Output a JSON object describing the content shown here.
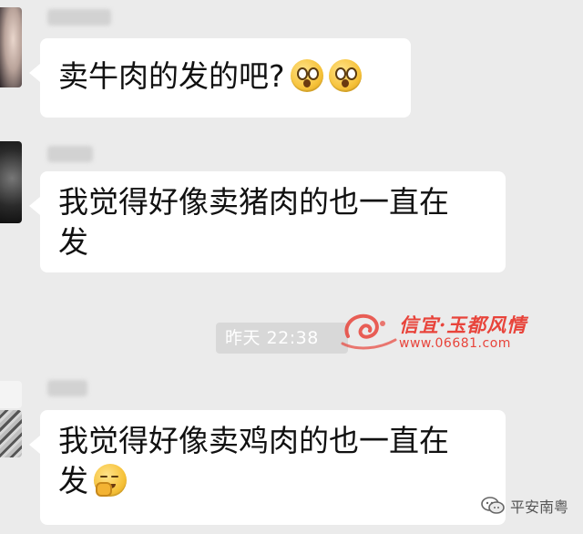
{
  "messages": [
    {
      "text": "卖牛肉的发的吧?",
      "emojis": [
        "astonished",
        "astonished"
      ]
    },
    {
      "line1": "我觉得好像卖猪肉的也一直在",
      "line2": "发"
    },
    {
      "line1": "我觉得好像卖鸡肉的也一直在",
      "line2": "发",
      "emoji": "shy"
    }
  ],
  "timestamp": "昨天 22:38",
  "watermark": {
    "title": "信宜·玉都风情",
    "url": "www.06681.com"
  },
  "footer": {
    "account": "平安南粤"
  },
  "colors": {
    "background": "#ebebeb",
    "bubble": "#ffffff",
    "watermark": "#e8443b"
  }
}
